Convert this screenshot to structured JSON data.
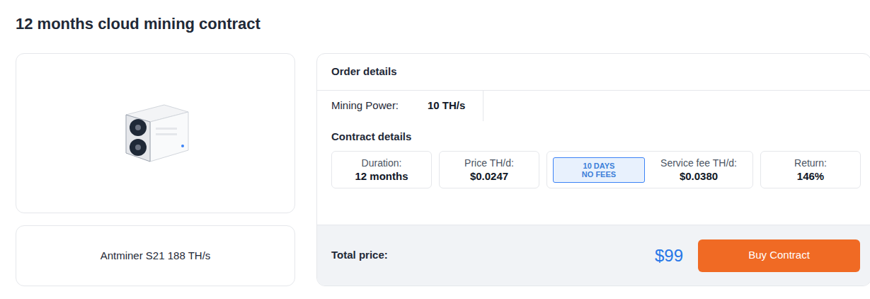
{
  "title": "12 months cloud mining contract",
  "product": {
    "name": "Antminer S21 188 TH/s"
  },
  "order": {
    "heading": "Order details",
    "mining_power": {
      "label": "Mining Power:",
      "value": "10 TH/s"
    }
  },
  "contract": {
    "heading": "Contract details",
    "items": [
      {
        "kind": "stat",
        "label": "Duration:",
        "value": "12 months"
      },
      {
        "kind": "stat",
        "label": "Price TH/d:",
        "value": "$0.0247"
      },
      {
        "kind": "fee",
        "badge": [
          "10 DAYS",
          "NO FEES"
        ],
        "label": "Service fee TH/d:",
        "value": "$0.0380"
      },
      {
        "kind": "stat",
        "label": "Return:",
        "value": "146%"
      }
    ]
  },
  "total": {
    "label": "Total price:",
    "value": "$99"
  },
  "buttons": [
    "Buy Contract"
  ]
}
